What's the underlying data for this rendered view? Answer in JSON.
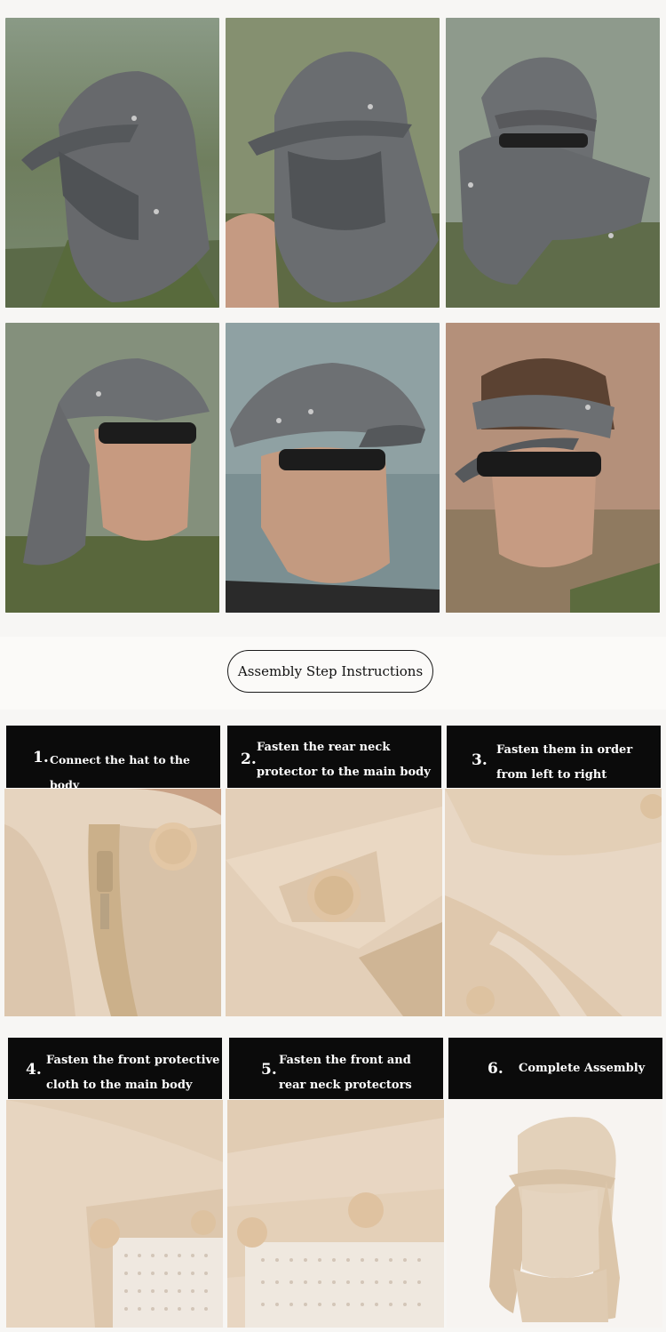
{
  "section": {
    "title": "Assembly Step Instructions"
  },
  "steps": [
    {
      "number": "1.",
      "text": "Connect the hat to the body"
    },
    {
      "number": "2.",
      "text": "Fasten the rear neck protector to the main body"
    },
    {
      "number": "3.",
      "text": "Fasten them in order from left to right"
    },
    {
      "number": "4.",
      "text": "Fasten the front protective cloth to the main body"
    },
    {
      "number": "5.",
      "text": "Fasten the front and rear neck protectors"
    },
    {
      "number": "6.",
      "text": "Complete Assembly"
    }
  ],
  "colors": {
    "hat_gray": "#6b6e71",
    "khaki": "#e5d3bd",
    "caption_bg": "#0b0b0b"
  }
}
